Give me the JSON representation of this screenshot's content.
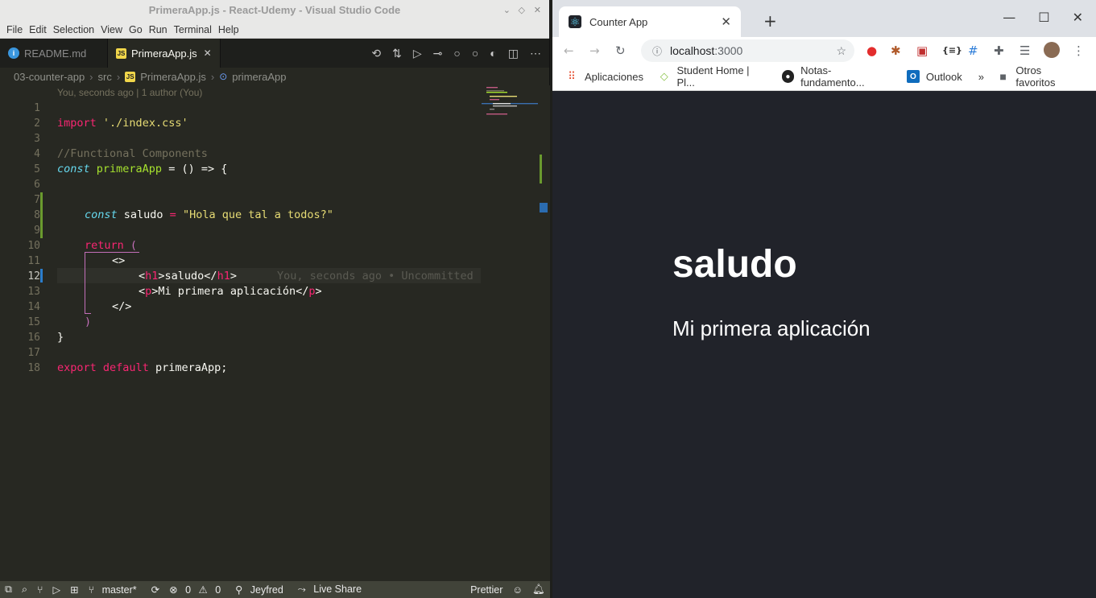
{
  "vscode": {
    "title": "PrimeraApp.js - React-Udemy - Visual Studio Code",
    "menu": [
      "File",
      "Edit",
      "Selection",
      "View",
      "Go",
      "Run",
      "Terminal",
      "Help"
    ],
    "tabs": [
      {
        "label": "README.md",
        "icon": "info-icon"
      },
      {
        "label": "PrimeraApp.js",
        "icon": "js-icon",
        "active": true
      }
    ],
    "breadcrumb": [
      "03-counter-app",
      "src",
      "PrimeraApp.js",
      "primeraApp"
    ],
    "blame_header": "You, seconds ago | 1 author (You)",
    "lines": [
      "1",
      "2",
      "3",
      "4",
      "5",
      "6",
      "7",
      "8",
      "9",
      "10",
      "11",
      "12",
      "13",
      "14",
      "15",
      "16",
      "17",
      "18"
    ],
    "code": {
      "l2_kw": "import",
      "l2_str": "'./index.css'",
      "l4_comment": "//Functional Components",
      "l5_const": "const",
      "l5_name": "primeraApp",
      "l5_rest": " = () => {",
      "l8_const": "const",
      "l8_name": " saludo ",
      "l8_eq": "=",
      "l8_str": " \"Hola que tal a todos?\"",
      "l10_return": "return",
      "l10_paren": " (",
      "l11": "<>",
      "l12_open": "<",
      "l12_tag": "h1",
      "l12_text": ">saludo</",
      "l12_tag2": "h1",
      "l12_close": ">",
      "l12_ghost": "You, seconds ago • Uncommitted",
      "l13_open": "<",
      "l13_tag": "p",
      "l13_text": ">Mi primera aplicación</",
      "l13_tag2": "p",
      "l13_close": ">",
      "l14": "</>",
      "l15": ")",
      "l16": "}",
      "l18_kw1": "export",
      "l18_kw2": "default",
      "l18_rest": " primeraApp;"
    },
    "status": {
      "branch": "master*",
      "errors": "0",
      "warnings": "0",
      "user": "Jeyfred",
      "live_share": "Live Share",
      "formatter": "Prettier"
    }
  },
  "chrome": {
    "tab_title": "Counter App",
    "url_host": "localhost",
    "url_port": ":3000",
    "bookmarks": [
      {
        "label": "Aplicaciones",
        "icon": "apps-grid-icon"
      },
      {
        "label": "Student Home | Pl...",
        "icon": "pluralsight-icon"
      },
      {
        "label": "Notas-fundamento...",
        "icon": "github-icon"
      },
      {
        "label": "Outlook",
        "icon": "outlook-icon"
      }
    ],
    "more_bookmarks": "»",
    "other_bookmarks": "Otros favoritos"
  },
  "page": {
    "heading": "saludo",
    "paragraph": "Mi primera aplicación"
  }
}
